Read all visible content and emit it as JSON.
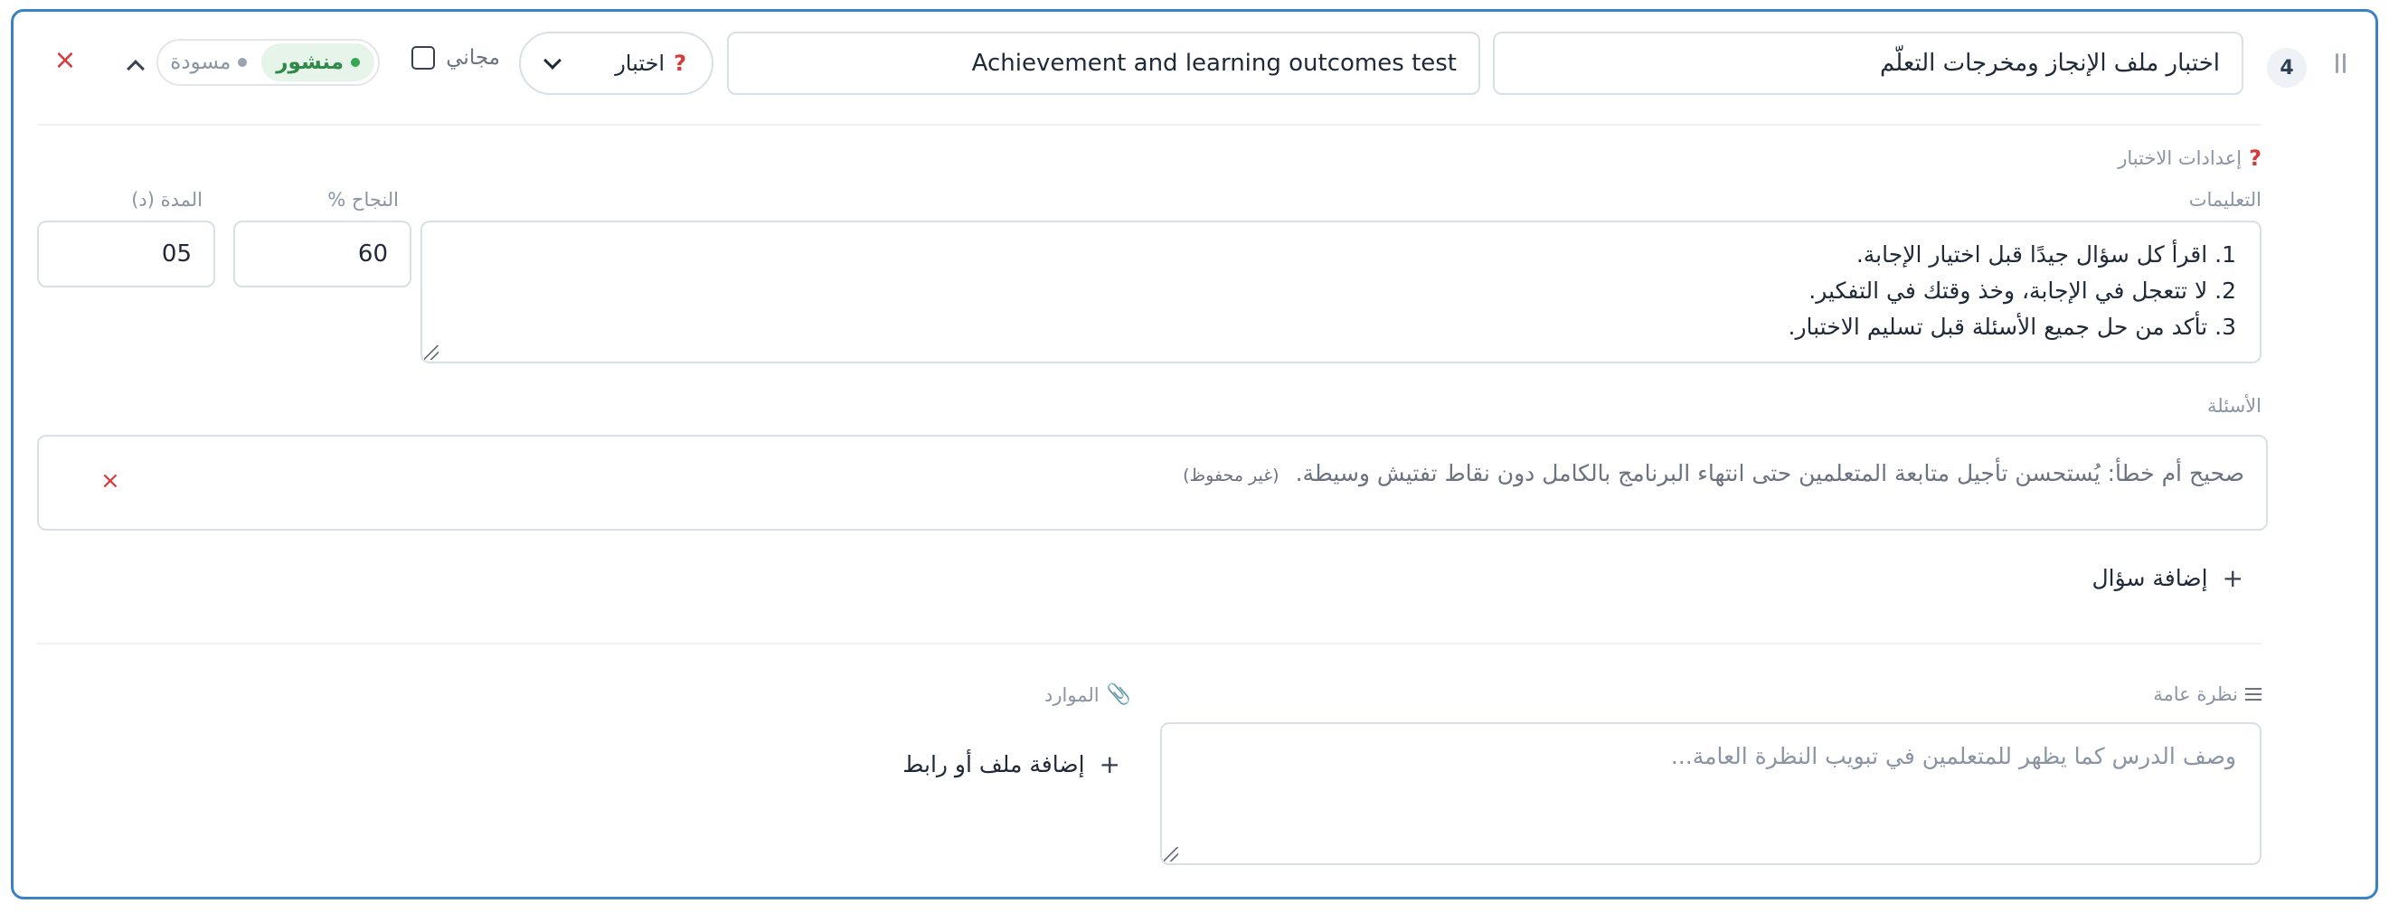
{
  "header": {
    "index": "4",
    "title_ar": "اختبار ملف الإنجاز ومخرجات التعلّم",
    "title_en": "Achievement and learning outcomes test",
    "type_select": {
      "help": "?",
      "label": "اختبار"
    },
    "free_label": "مجاني",
    "status": {
      "published": "منشور",
      "draft": "مسودة"
    },
    "close": "×"
  },
  "settings": {
    "help": "?",
    "title": "إعدادات الاختبار",
    "instructions_label": "التعليمات",
    "instructions_lines": [
      "1. اقرأ كل سؤال جيدًا قبل اختيار الإجابة.",
      "2. لا تتعجل في الإجابة، وخذ وقتك في التفكير.",
      "3. تأكد من حل جميع الأسئلة قبل تسليم الاختبار."
    ],
    "pass_label": "النجاح %",
    "pass_value": "60",
    "duration_label": "المدة (د)",
    "duration_value": "05"
  },
  "questions": {
    "label": "الأسئلة",
    "items": [
      {
        "text": "صحيح أم خطأ: يُستحسن تأجيل متابعة المتعلمين حتى انتهاء البرنامج بالكامل دون نقاط تفتيش وسيطة.",
        "unsaved": "(غير محفوظ)",
        "delete": "×"
      }
    ],
    "add_label": "إضافة سؤال",
    "add_plus": "+"
  },
  "overview": {
    "label": "نظرة عامة",
    "placeholder": "وصف الدرس كما يظهر للمتعلمين في تبويب النظرة العامة..."
  },
  "resources": {
    "label": "الموارد",
    "add_label": "إضافة ملف أو رابط",
    "add_plus": "+"
  },
  "colors": {
    "accent_border": "#3b82c4",
    "danger": "#d63a3a",
    "published": "#2f8a4a"
  }
}
